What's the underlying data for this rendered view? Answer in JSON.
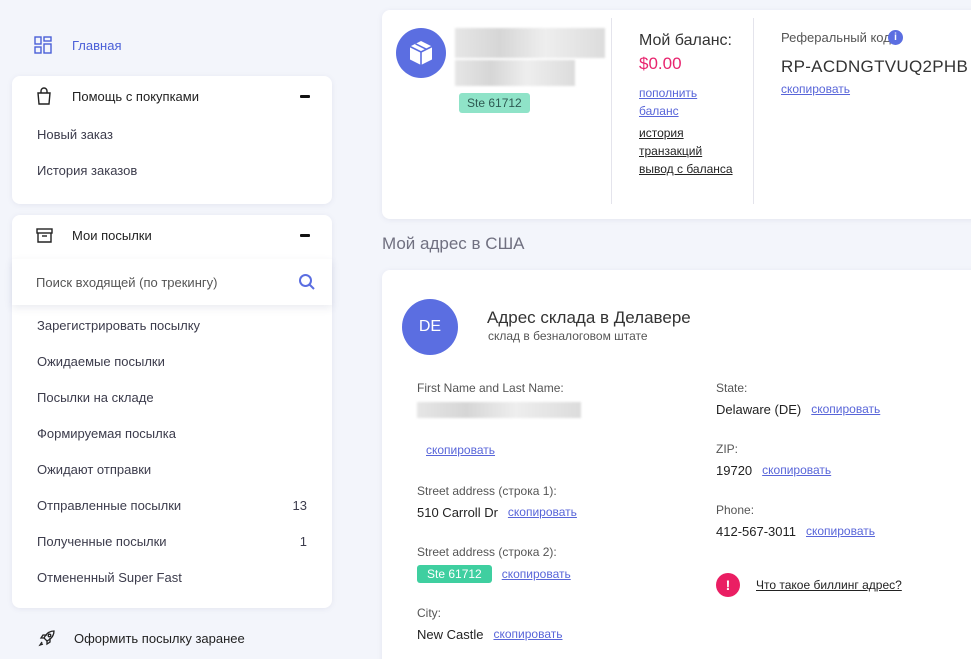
{
  "sidebar": {
    "home": "Главная",
    "purchase_help": {
      "title": "Помощь с покупками",
      "items": [
        "Новый заказ",
        "История заказов"
      ]
    },
    "parcels": {
      "title": "Мои посылки",
      "search_placeholder": "Поиск входящей (по трекингу)",
      "items": [
        {
          "label": "Зарегистрировать посылку",
          "count": ""
        },
        {
          "label": "Ожидаемые посылки",
          "count": ""
        },
        {
          "label": "Посылки на складе",
          "count": ""
        },
        {
          "label": "Формируемая посылка",
          "count": ""
        },
        {
          "label": "Ожидают отправки",
          "count": ""
        },
        {
          "label": "Отправленные посылки",
          "count": "13"
        },
        {
          "label": "Полученные посылки",
          "count": "1"
        },
        {
          "label": "Отмененный Super Fast",
          "count": ""
        }
      ]
    },
    "preorder": "Оформить посылку заранее"
  },
  "profile": {
    "suite": "Ste 61712",
    "balance_title": "Мой баланс:",
    "balance_amount": "$0.00",
    "topup_link": "пополнить баланс",
    "transactions_link": "история транзакций",
    "withdraw_link": "вывод с баланса",
    "referral_title": "Реферальный код:",
    "referral_code": "RP-ACDNGTVUQ2PHB",
    "copy_link": "скопировать"
  },
  "us_address": {
    "section_title": "Мой адрес в США",
    "badge": "DE",
    "title": "Адрес склада в Делавере",
    "subtitle": "склад в безналоговом штате",
    "copy": "скопировать",
    "name_label": "First Name and Last Name:",
    "street1_label": "Street address (строка 1):",
    "street1_value": "510 Carroll Dr",
    "street2_label": "Street address (строка 2):",
    "street2_value": "Ste 61712",
    "city_label": "City:",
    "city_value": "New Castle",
    "state_label": "State:",
    "state_value": "Delaware (DE)",
    "zip_label": "ZIP:",
    "zip_value": "19720",
    "phone_label": "Phone:",
    "phone_value": "412-567-3011",
    "billing_link": "Что такое биллинг адрес?"
  },
  "colors": {
    "accent": "#5b6ee1",
    "balance": "#e8246e",
    "badge_green": "#3fcfa0",
    "warning": "#ea1e63"
  }
}
